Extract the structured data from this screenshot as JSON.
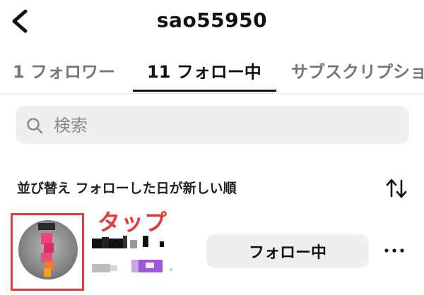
{
  "header": {
    "title": "sao55950"
  },
  "tabs": [
    {
      "label": "1 フォロワー"
    },
    {
      "label": "11 フォロー中"
    },
    {
      "label": "サブスクリプション"
    }
  ],
  "search": {
    "placeholder": "検索"
  },
  "sort": {
    "label": "並び替え フォローした日が新しい順"
  },
  "annotation": {
    "tap_label": "タップ",
    "color": "#e53a3a"
  },
  "user": {
    "follow_button_label": "フォロー中"
  },
  "icons": {
    "back": "chevron-left-icon",
    "search": "search-icon",
    "sort": "sort-arrows-icon",
    "more": "ellipsis-icon"
  }
}
